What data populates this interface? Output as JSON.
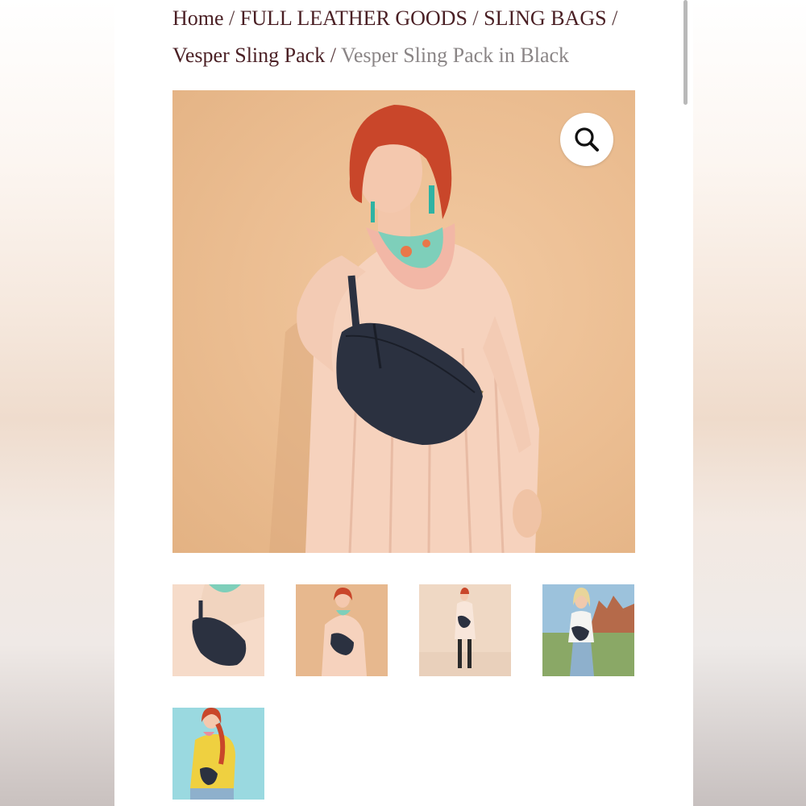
{
  "breadcrumb": {
    "home": "Home",
    "category": "FULL LEATHER GOODS",
    "subcategory": "SLING BAGS",
    "product": "Vesper Sling Pack",
    "current": "Vesper Sling Pack in Black",
    "separator": "/"
  },
  "gallery": {
    "main_image_icon": "magnifier-zoom-icon",
    "thumbnails": [
      {
        "icon": "product-thumbnail-closeup"
      },
      {
        "icon": "product-thumbnail-portrait"
      },
      {
        "icon": "product-thumbnail-full-body"
      },
      {
        "icon": "product-thumbnail-outdoor"
      },
      {
        "icon": "product-thumbnail-yellow-sweater"
      }
    ]
  },
  "colors": {
    "link": "#4a1f24",
    "current_crumb": "#8a8586",
    "studio_background": "#ebbd91",
    "bag": "#2b3140"
  }
}
